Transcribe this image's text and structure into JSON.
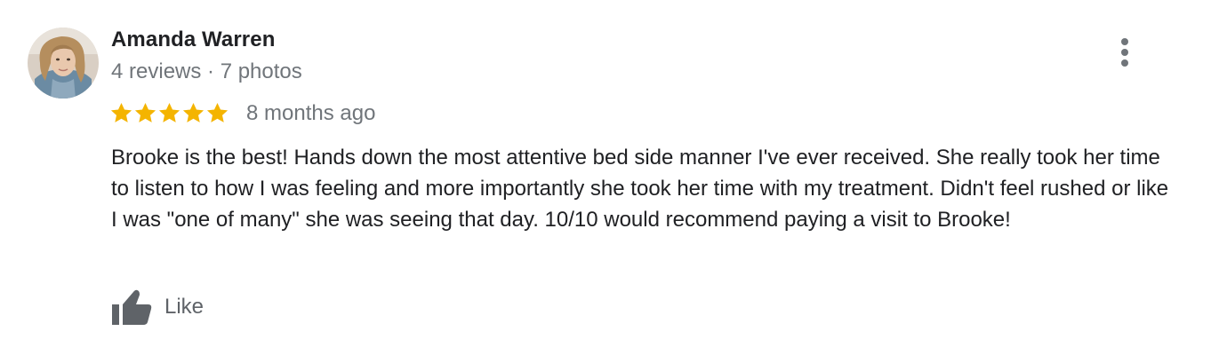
{
  "review": {
    "author": {
      "name": "Amanda Warren",
      "meta": "4 reviews · 7 photos"
    },
    "rating": {
      "stars": 5,
      "max": 5,
      "star_color": "#f4b400",
      "icon": "star-icon"
    },
    "time_ago": "8 months ago",
    "text": "Brooke is the best! Hands down the most attentive bed side manner I've ever received. She really took her time to listen to how I was feeling and more importantly she took her time with my treatment. Didn't feel rushed or like I was \"one of many\" she was seeing that day. 10/10 would recommend paying a visit to Brooke!",
    "actions": {
      "like_label": "Like",
      "like_icon": "thumbs-up-icon",
      "more_icon": "more-vertical-icon"
    }
  },
  "colors": {
    "text_primary": "#202124",
    "text_secondary": "#70757a",
    "icon_gray": "#5f6368"
  }
}
